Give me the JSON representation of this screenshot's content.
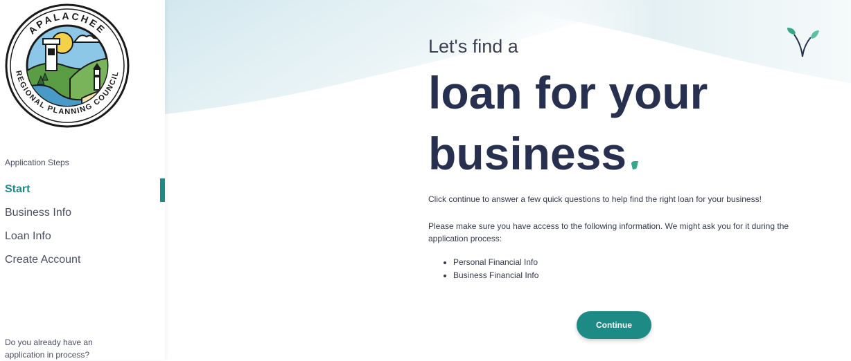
{
  "sidebar": {
    "logo": {
      "text_top": "APALACHEE",
      "text_bottom": "REGIONAL PLANNING COUNCIL"
    },
    "steps_heading": "Application Steps",
    "steps": [
      {
        "label": "Start",
        "active": true
      },
      {
        "label": "Business Info",
        "active": false
      },
      {
        "label": "Loan Info",
        "active": false
      },
      {
        "label": "Create Account",
        "active": false
      }
    ],
    "footer_text": "Do you already have an application in process?"
  },
  "main": {
    "kicker": "Let's find a",
    "headline_line1": "loan for your",
    "headline_line2": "business",
    "intro": "Click continue to answer a few quick questions to help find the right loan for your business!",
    "requirements": "Please make sure you have access to the following information. We might ask you for it during the application process:",
    "info_items": [
      "Personal Financial Info",
      "Business Financial Info"
    ],
    "continue_label": "Continue"
  },
  "colors": {
    "accent": "#1e8a85",
    "headline": "#27304f",
    "dot": "#36a88a"
  },
  "icons": {
    "decoration": "sprout-icon",
    "headline_dot": "dot-icon"
  }
}
